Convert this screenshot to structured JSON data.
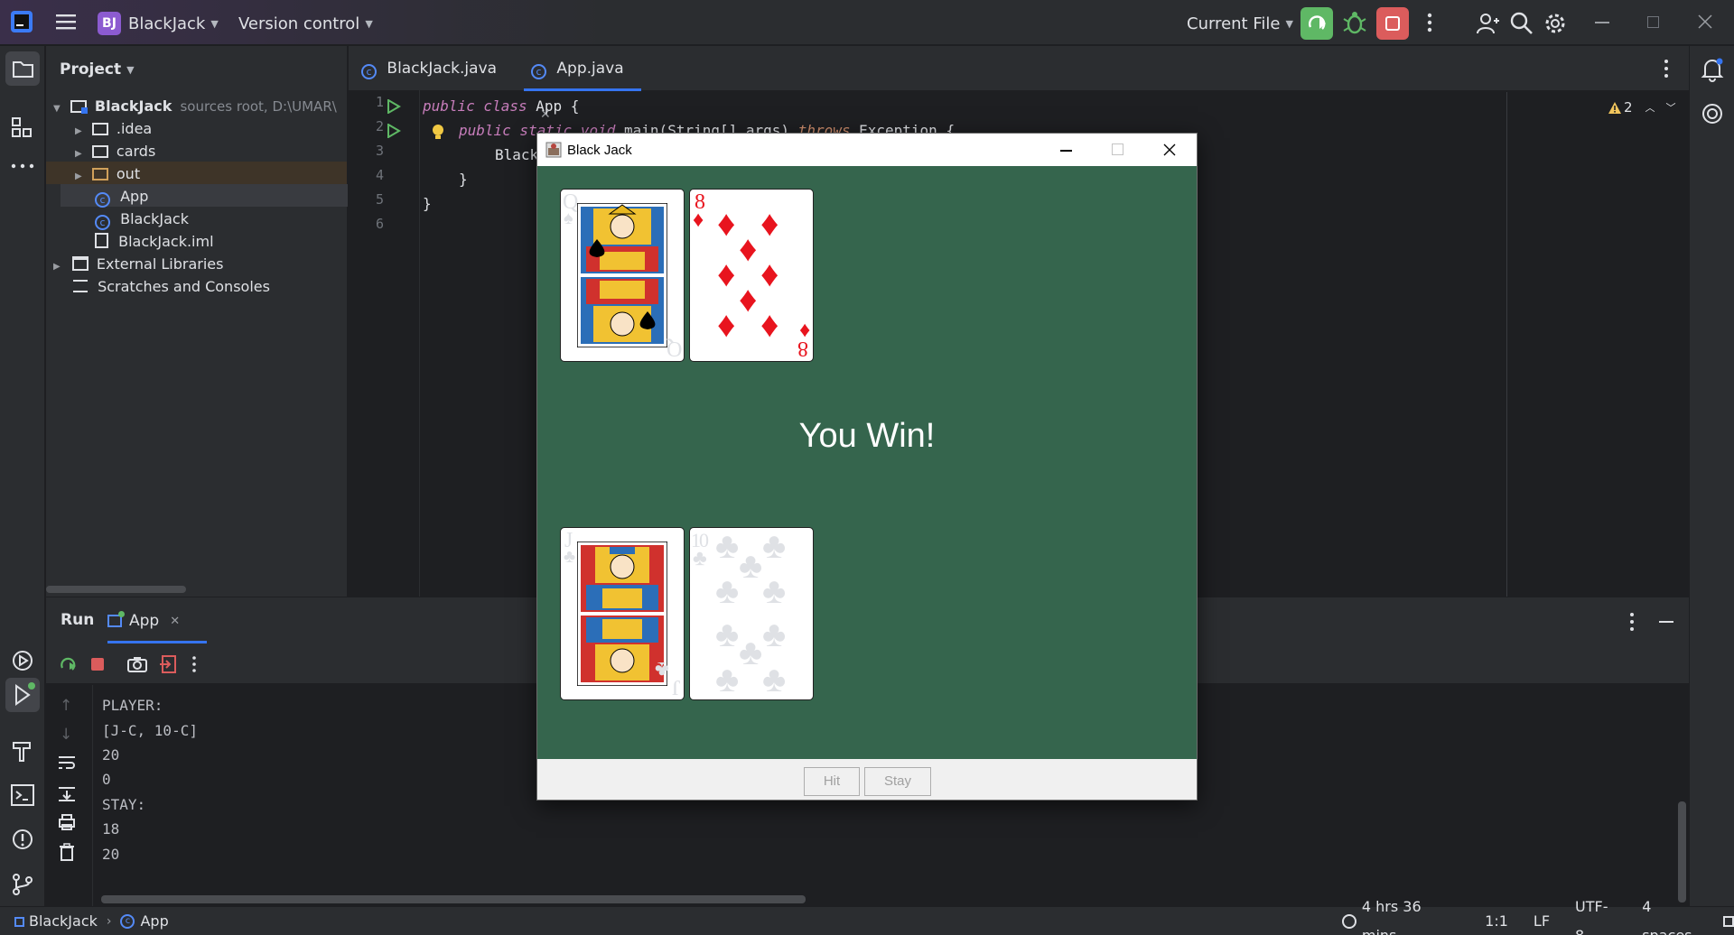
{
  "titlebar": {
    "project_badge": "BJ",
    "project_name": "BlackJack",
    "vcs_label": "Version control",
    "run_config": "Current File"
  },
  "project_panel": {
    "title": "Project",
    "tree": [
      {
        "label": "BlackJack",
        "note": "sources root,  D:\\UMAR\\"
      },
      {
        "label": ".idea"
      },
      {
        "label": "cards"
      },
      {
        "label": "out"
      },
      {
        "label": "App"
      },
      {
        "label": "BlackJack"
      },
      {
        "label": "BlackJack.iml"
      },
      {
        "label": "External Libraries"
      },
      {
        "label": "Scratches and Consoles"
      }
    ]
  },
  "editor": {
    "tabs": [
      {
        "label": "BlackJack.java"
      },
      {
        "label": "App.java"
      }
    ],
    "line_numbers": [
      "1",
      "2",
      "3",
      "4",
      "5",
      "6"
    ],
    "code": {
      "line1_kw": "public class",
      "line1_rest": " App {",
      "line2_kw": "public static void",
      "line2_rest": " main(String[] args) ",
      "line2_throws": "throws",
      "line2_end": " Exception {",
      "line3": "Black",
      "line4": "}",
      "line5": "}"
    },
    "warnings_count": "2"
  },
  "run_panel": {
    "title": "Run",
    "tab_label": "App",
    "output": [
      "PLAYER:",
      "[J-C, 10-C]",
      "20",
      "0",
      "STAY:",
      "18",
      "20"
    ]
  },
  "statusbar": {
    "breadcrumb_project": "BlackJack",
    "breadcrumb_file": "App",
    "time": "4 hrs 36 mins",
    "position": "1:1",
    "line_ending": "LF",
    "encoding": "UTF-8",
    "indent": "4 spaces"
  },
  "blackjack_window": {
    "title": "Black Jack",
    "result_text": "You Win!",
    "hit_label": "Hit",
    "stay_label": "Stay",
    "dealer_cards": [
      {
        "rank": "Q",
        "suit": "♠",
        "color": "#000000"
      },
      {
        "rank": "8",
        "suit": "♦",
        "color": "#e8141e"
      }
    ],
    "player_cards": [
      {
        "rank": "J",
        "suit": "♣",
        "color": "#000000"
      },
      {
        "rank": "10",
        "suit": "♣",
        "color": "#000000"
      }
    ],
    "table_color": "#35654d"
  },
  "colors": {
    "accent_green": "#5fb865",
    "stop_red": "#db5c5c",
    "ide_background": "#1e1f22",
    "panel_background": "#2b2d30"
  }
}
